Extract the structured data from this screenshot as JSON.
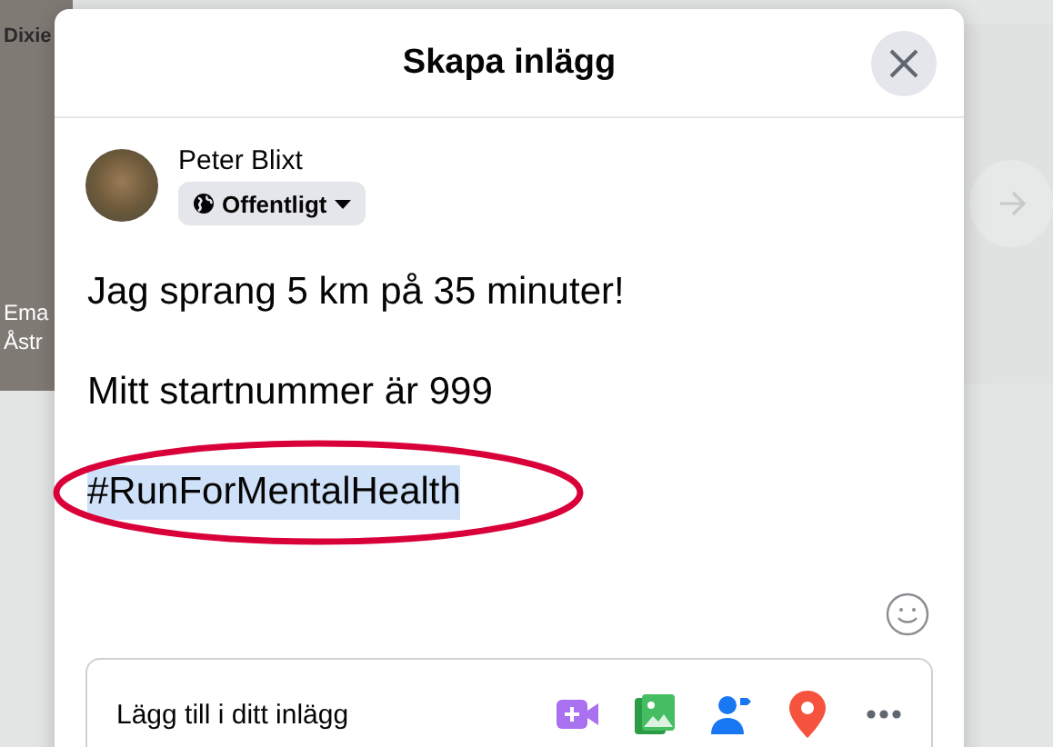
{
  "background": {
    "story_texts": [
      "Dixie",
      "Ema",
      "Åstr"
    ]
  },
  "dialog": {
    "title": "Skapa inlägg",
    "author": {
      "name": "Peter Blixt",
      "audience": "Offentligt"
    },
    "post_lines": [
      {
        "text": "Jag sprang 5 km på 35 minuter!",
        "selected": false,
        "circled": false
      },
      {
        "text": "Mitt startnummer är 999",
        "selected": false,
        "circled": false
      },
      {
        "text": "#RunForMentalHealth",
        "selected": true,
        "circled": true
      }
    ],
    "add_to_post": {
      "label": "Lägg till i ditt inlägg"
    }
  }
}
